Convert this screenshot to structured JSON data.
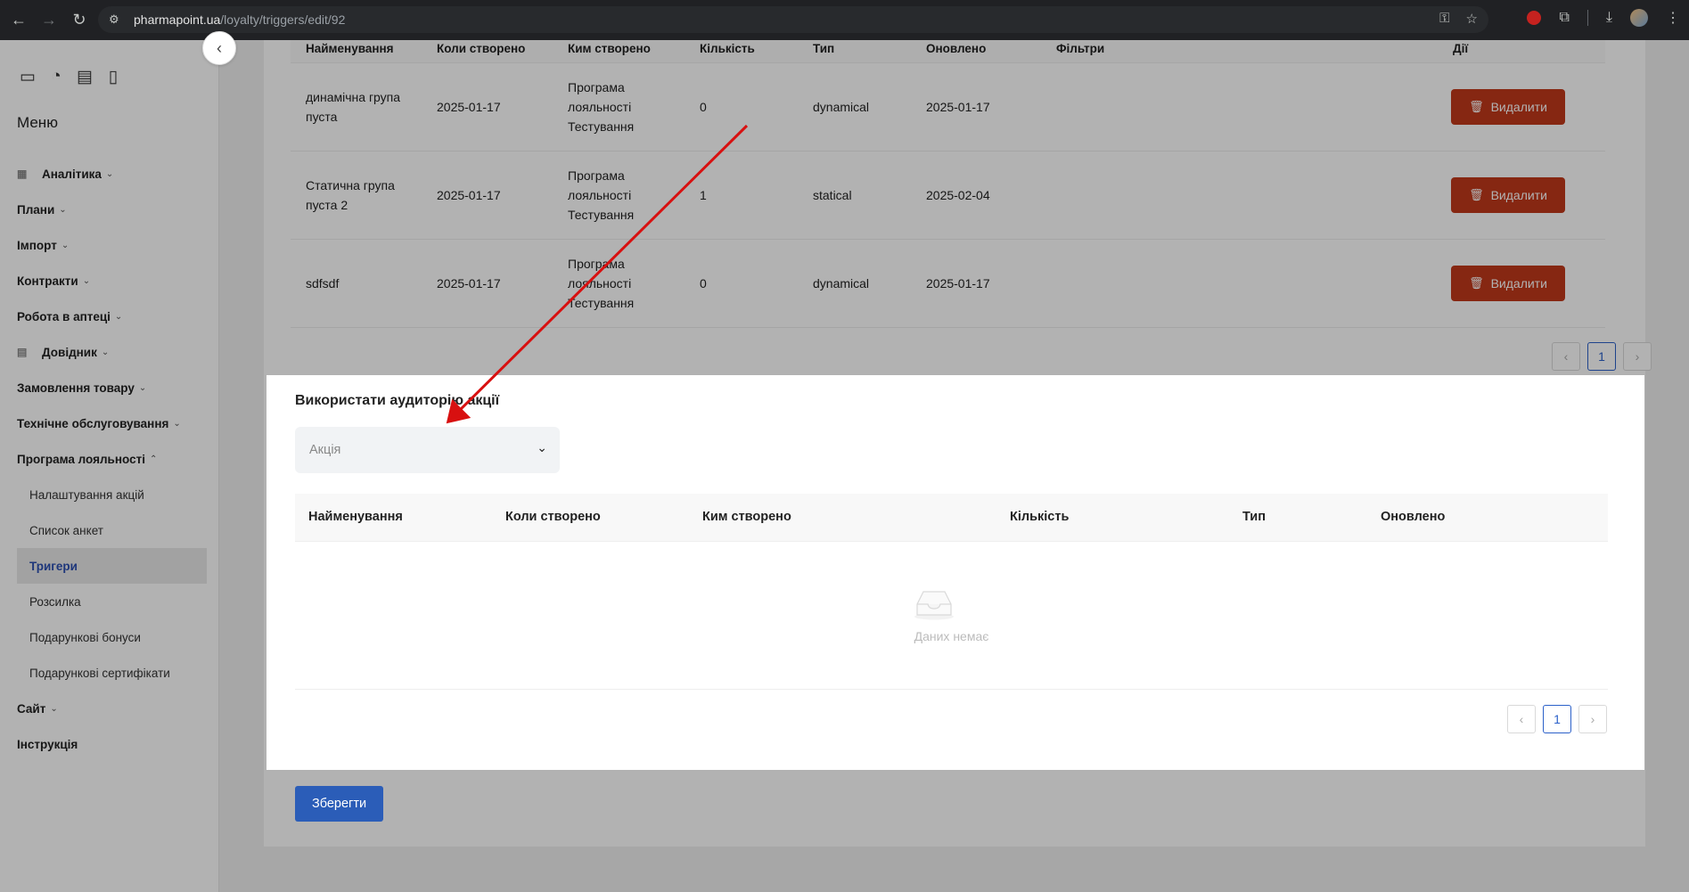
{
  "browser": {
    "url_host": "pharmapoint.ua",
    "url_path": "/loyalty/triggers/edit/92"
  },
  "sidebar": {
    "menu_title": "Меню",
    "items": [
      {
        "label": "Аналітика",
        "kind": "section",
        "chevron": "⌄",
        "icon": "▦"
      },
      {
        "label": "Плани",
        "kind": "section",
        "chevron": "⌄"
      },
      {
        "label": "Імпорт",
        "kind": "section",
        "chevron": "⌄"
      },
      {
        "label": "Контракти",
        "kind": "section",
        "chevron": "⌄"
      },
      {
        "label": "Робота в аптеці",
        "kind": "section",
        "chevron": "⌄"
      },
      {
        "label": "Довідник",
        "kind": "section",
        "chevron": "⌄",
        "icon": "▤"
      },
      {
        "label": "Замовлення товару",
        "kind": "section",
        "chevron": "⌄"
      },
      {
        "label": "Технічне обслуговування",
        "kind": "section",
        "chevron": "⌄"
      },
      {
        "label": "Програма лояльності",
        "kind": "section",
        "chevron": "⌃"
      },
      {
        "label": "Налаштування акцій",
        "kind": "sub"
      },
      {
        "label": "Список анкет",
        "kind": "sub"
      },
      {
        "label": "Тригери",
        "kind": "active"
      },
      {
        "label": "Розсилка",
        "kind": "sub"
      },
      {
        "label": "Подарункові бонуси",
        "kind": "sub"
      },
      {
        "label": "Подарункові сертифікати",
        "kind": "sub"
      },
      {
        "label": "Сайт",
        "kind": "section",
        "chevron": "⌄"
      },
      {
        "label": "Інструкція",
        "kind": "plain"
      }
    ]
  },
  "groups_table": {
    "headers": [
      "Найменування",
      "Коли створено",
      "Ким створено",
      "Кількість",
      "Тип",
      "Оновлено",
      "Фільтри",
      "Дії"
    ],
    "rows": [
      {
        "name_l1": "динамічна група",
        "name_l2": "пуста",
        "created": "2025-01-17",
        "by_l1": "Програма",
        "by_l2": "лояльності",
        "by_l3": "Тестування",
        "count": "0",
        "type": "dynamical",
        "updated": "2025-01-17",
        "action": "Видалити"
      },
      {
        "name_l1": "Статична група",
        "name_l2": "пуста 2",
        "created": "2025-01-17",
        "by_l1": "Програма",
        "by_l2": "лояльності",
        "by_l3": "Тестування",
        "count": "1",
        "type": "statical",
        "updated": "2025-02-04",
        "action": "Видалити"
      },
      {
        "name_l1": "sdfsdf",
        "name_l2": "",
        "created": "2025-01-17",
        "by_l1": "Програма",
        "by_l2": "лояльності",
        "by_l3": "Тестування",
        "count": "0",
        "type": "dynamical",
        "updated": "2025-01-17",
        "action": "Видалити"
      }
    ],
    "page": "1"
  },
  "audience": {
    "title": "Використати аудиторію акції",
    "select_placeholder": "Акція",
    "headers": [
      "Найменування",
      "Коли створено",
      "Ким створено",
      "Кількість",
      "Тип",
      "Оновлено"
    ],
    "empty_text": "Даних немає",
    "page": "1"
  },
  "save_label": "Зберегти",
  "colors": {
    "accent": "#2b5db8",
    "danger": "#c0381b",
    "annotation": "#d81010"
  }
}
